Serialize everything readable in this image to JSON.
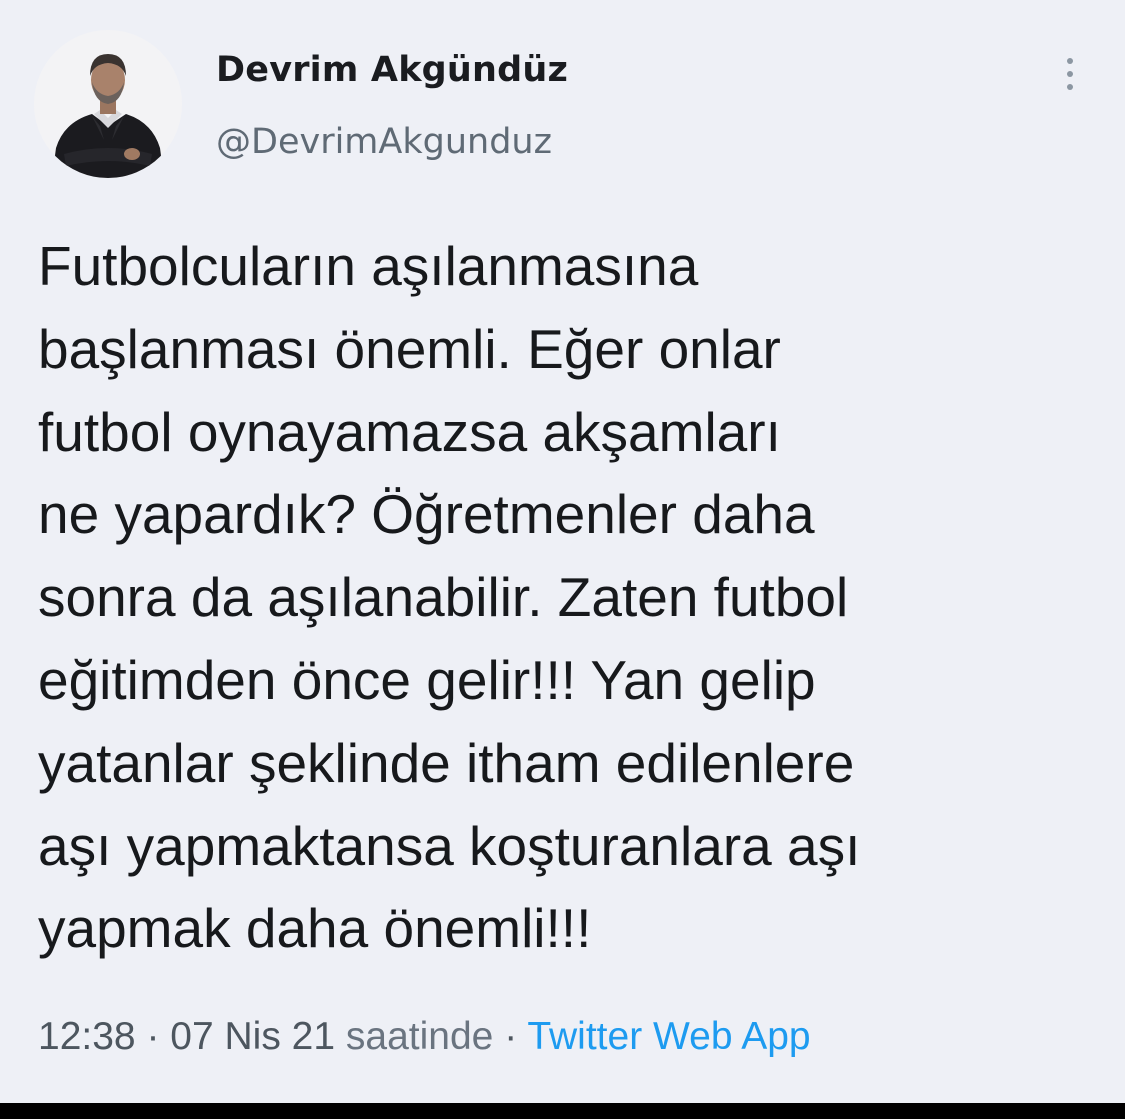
{
  "tweet": {
    "author": {
      "display_name": "Devrim Akgündüz",
      "handle": "@DevrimAkgunduz"
    },
    "text_lines": [
      "Futbolcuların aşılanmasına",
      "başlanması önemli. Eğer onlar",
      "futbol oynayamazsa akşamları",
      "ne yapardık? Öğretmenler daha",
      "sonra da aşılanabilir. Zaten futbol",
      "eğitimden önce gelir!!! Yan gelip",
      "yatanlar şeklinde itham edilenlere",
      "aşı yapmaktansa koşturanlara aşı",
      "yapmak daha önemli!!!"
    ],
    "meta": {
      "time": "12:38",
      "separator": "·",
      "date": "07 Nis 21",
      "date_suffix": "saatinde",
      "source": "Twitter Web App"
    },
    "icons": {
      "more": "more-vertical-icon",
      "avatar": "avatar-photo"
    },
    "colors": {
      "background": "#eef0f6",
      "text": "#17191c",
      "secondary": "#5f6a75",
      "link": "#1d9bf0"
    }
  }
}
